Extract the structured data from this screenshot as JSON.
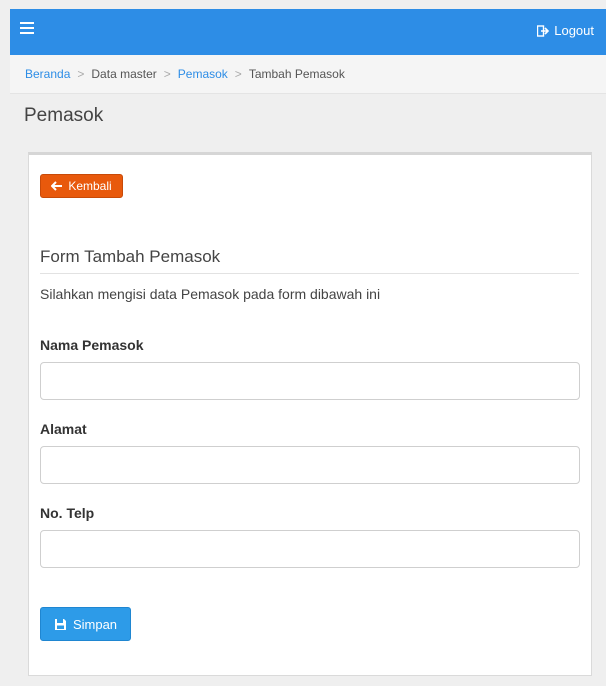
{
  "topbar": {
    "menu_icon": "hamburger-menu-icon",
    "logout_label": "Logout",
    "logout_icon": "sign-out-icon",
    "color": "#2d8de6"
  },
  "breadcrumb": {
    "items": [
      "Beranda",
      "Data master",
      "Pemasok",
      "Tambah Pemasok"
    ]
  },
  "page": {
    "title": "Pemasok"
  },
  "panel": {
    "back_label": "Kembali",
    "back_icon": "arrow-left-icon",
    "back_color": "#e8590c",
    "form_title": "Form Tambah Pemasok",
    "form_desc": "Silahkan mengisi data Pemasok pada form dibawah ini",
    "fields": [
      {
        "label": "Nama Pemasok",
        "value": "",
        "placeholder": ""
      },
      {
        "label": "Alamat",
        "value": "",
        "placeholder": ""
      },
      {
        "label": "No. Telp",
        "value": "",
        "placeholder": ""
      }
    ],
    "save_label": "Simpan",
    "save_icon": "floppy-disk-icon",
    "save_color": "#2d9be8"
  }
}
